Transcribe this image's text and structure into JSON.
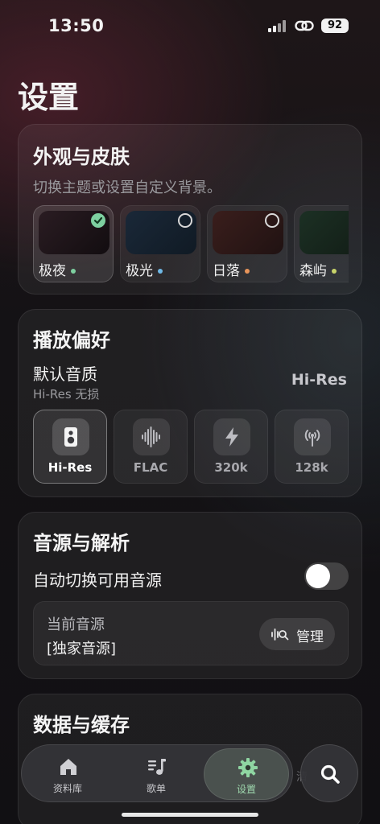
{
  "status": {
    "time": "13:50",
    "battery": "92"
  },
  "page": {
    "title": "设置"
  },
  "appearance": {
    "title": "外观与皮肤",
    "subtitle": "切换主题或设置自定义背景。",
    "themes": [
      {
        "name": "极夜",
        "dot_color": "#7ed0a0",
        "selected": true
      },
      {
        "name": "极光",
        "dot_color": "#6fb8e6",
        "selected": false
      },
      {
        "name": "日落",
        "dot_color": "#e8945a",
        "selected": false
      },
      {
        "name": "森屿",
        "dot_color": "#c8d46a",
        "selected": false
      }
    ]
  },
  "playback": {
    "title": "播放偏好",
    "quality_label": "默认音质",
    "quality_sub": "Hi-Res 无损",
    "quality_value": "Hi-Res",
    "options": [
      {
        "label": "Hi-Res",
        "icon": "speaker-icon",
        "selected": true
      },
      {
        "label": "FLAC",
        "icon": "waveform-icon",
        "selected": false
      },
      {
        "label": "320k",
        "icon": "bolt-icon",
        "selected": false
      },
      {
        "label": "128k",
        "icon": "antenna-icon",
        "selected": false
      }
    ]
  },
  "source": {
    "title": "音源与解析",
    "auto_switch_label": "自动切换可用音源",
    "auto_switch_on": false,
    "current_label": "当前音源",
    "current_value": "[独家音源]",
    "manage_label": "管理"
  },
  "data_cache": {
    "title": "数据与缓存"
  },
  "nav": {
    "items": [
      {
        "label": "资料库",
        "icon": "home-icon",
        "active": false
      },
      {
        "label": "歌单",
        "icon": "playlist-icon",
        "active": false
      },
      {
        "label": "设置",
        "icon": "gear-icon",
        "active": true
      }
    ],
    "ghost_text": "清"
  },
  "colors": {
    "accent": "#7ed0a0",
    "active_nav_text": "#9fd8ae"
  }
}
